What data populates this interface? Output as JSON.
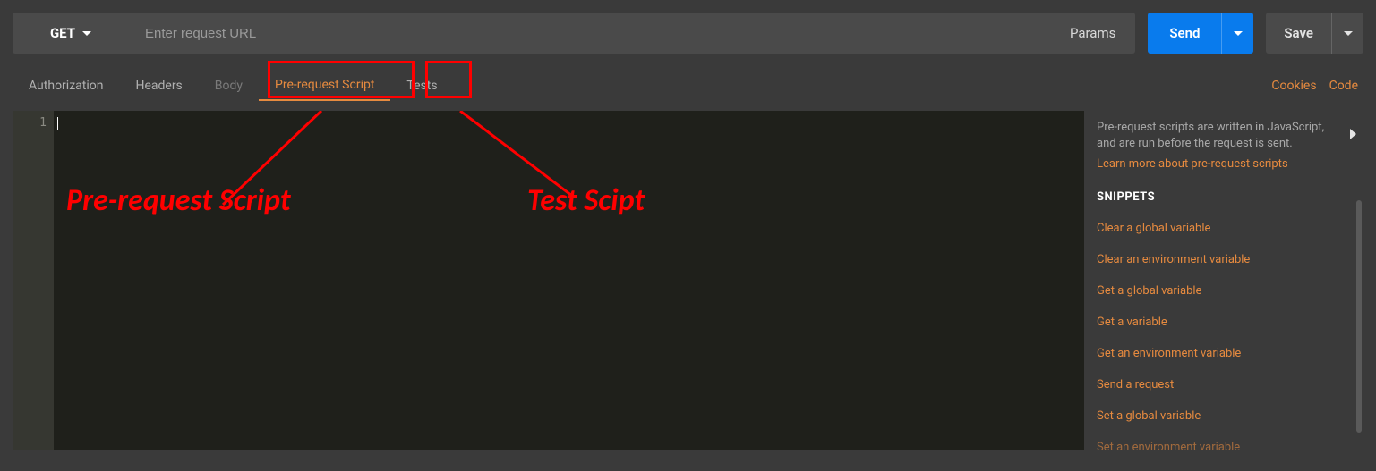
{
  "topbar": {
    "method": "GET",
    "url_placeholder": "Enter request URL",
    "params_label": "Params",
    "send_label": "Send",
    "save_label": "Save"
  },
  "tabs": {
    "items": [
      {
        "label": "Authorization"
      },
      {
        "label": "Headers"
      },
      {
        "label": "Body"
      },
      {
        "label": "Pre-request Script"
      },
      {
        "label": "Tests"
      }
    ],
    "right_links": {
      "cookies": "Cookies",
      "code": "Code"
    }
  },
  "editor": {
    "line_number": "1"
  },
  "annotations": {
    "pre_request_label": "Pre-request Script",
    "tests_label": "Test Scipt"
  },
  "sidebar": {
    "help_text": "Pre-request scripts are written in JavaScript, and are run before the request is sent.",
    "learn_more": "Learn more about pre-request scripts",
    "snippets_heading": "SNIPPETS",
    "snippets": [
      "Clear a global variable",
      "Clear an environment variable",
      "Get a global variable",
      "Get a variable",
      "Get an environment variable",
      "Send a request",
      "Set a global variable",
      "Set an environment variable"
    ]
  }
}
